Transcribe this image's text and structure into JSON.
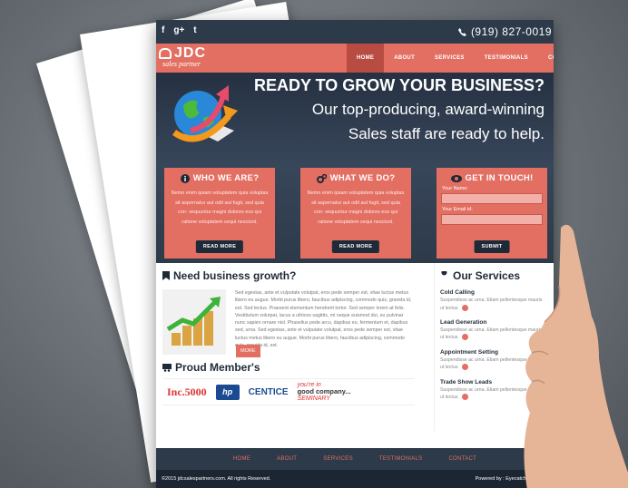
{
  "topbar": {
    "social": [
      "f",
      "g+",
      "t"
    ],
    "phone": "(919) 827-0019"
  },
  "logo": {
    "main": "JDC",
    "sub": "sales partner"
  },
  "nav": [
    "HOME",
    "ABOUT",
    "SERVICES",
    "TESTIMONIALS",
    "CONTACTS"
  ],
  "hero": {
    "title": "READY TO GROW YOUR BUSINESS?",
    "line1": "Our top-producing, award-winning",
    "line2": "Sales staff are ready to help."
  },
  "cards": {
    "who": {
      "title": "WHO WE ARE?",
      "text": "Nemo enim ipsam voluptatem quia voluptas sit aspernatur aut odit aut fugit, sed quia con- sequuntur magni dolores eos qui ratione voluptatem sequi nesciunt.",
      "button": "READ MORE"
    },
    "what": {
      "title": "WHAT WE DO?",
      "text": "Nemo enim ipsam voluptatem quia voluptas sit aspernatur aut odit aut fugit, sed quia con- sequuntur magni dolores eos qui ratione voluptatem sequi nesciunt.",
      "button": "READ MORE"
    },
    "touch": {
      "title": "GET IN TOUCH!",
      "name_label": "Your Name:",
      "email_label": "Your Email id:",
      "button": "SUBMIT"
    }
  },
  "growth": {
    "title": "Need business growth?",
    "text": "Sed egestas, ante et vulputate volutpat, eros pede semper est, vitae luctus metus libero eu augue. Morbi purus libero, faucibus adipiscing, commodo quis, gravida id, est. Sed lectus. Praesent elementum hendrerit tortor. Sed semper lorem at felis. Vestibulum volutpat, lacus a ultrices sagittis, mi neque euismod dui, eu pulvinar nunc sapien ornare nisl. Phasellus pede arcu, dapibus eu, fermentum et, dapibus sed, urna. Sed egestas, ante et vulputate volutpat, eros pede semper est, vitae luctus metus libero eu augue. Morbi purus libero, faucibus adipiscing, commodo quis, gravida id, est.",
    "button": "MORE"
  },
  "members": {
    "title": "Proud Member's",
    "logos": {
      "inc_prefix": "Inc.",
      "inc_num": "5000",
      "hp": "hp",
      "centice": "CENTICE",
      "gc_top": "you're in",
      "gc_main": "good company...",
      "gc_sub": "SEMINARY"
    }
  },
  "services": {
    "title": "Our Services",
    "items": [
      {
        "title": "Cold Calling",
        "text": "Suspendisse ac urna. Etiam pellentesque mauris ut lectus."
      },
      {
        "title": "Lead Generation",
        "text": "Suspendisse ac urna. Etiam pellentesque mauris ut lectus."
      },
      {
        "title": "Appointment Setting",
        "text": "Suspendisse ac urna. Etiam pellentesque mauris ut lectus."
      },
      {
        "title": "Trade Show Leads",
        "text": "Suspendisse ac urna. Etiam pellentesque mauris ut lectus."
      }
    ]
  },
  "footer": {
    "links": [
      "HOME",
      "ABOUT",
      "SERVICES",
      "TESTIMONIALS",
      "CONTACT"
    ],
    "copyright": "©2015 jdcsalespartners.com. All rights Reserved.",
    "powered": "Powered by : Eyecatchy Designs"
  },
  "colors": {
    "coral": "#e36f63",
    "navy": "#2d3a4a",
    "dark": "#1f2a38"
  }
}
